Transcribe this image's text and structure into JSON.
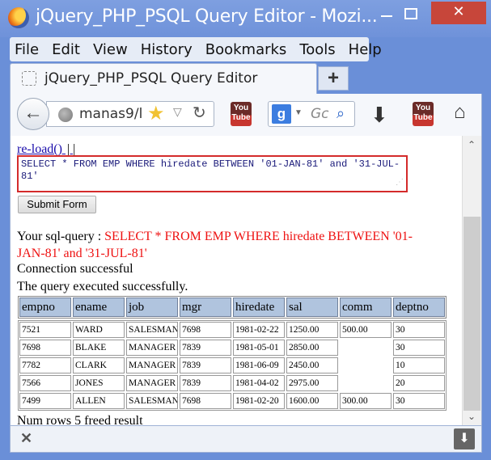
{
  "window": {
    "title": "jQuery_PHP_PSQL Query Editor - Mozi...",
    "close_glyph": "✕"
  },
  "menu": [
    "File",
    "Edit",
    "View",
    "History",
    "Bookmarks",
    "Tools",
    "Help"
  ],
  "tab": {
    "label": "jQuery_PHP_PSQL Query Editor",
    "new_tab": "+"
  },
  "navbar": {
    "url": "manas9/l",
    "search_engine": "g",
    "search_placeholder": "Gc",
    "youtube_label": "You Tube"
  },
  "page": {
    "reload_link": "re-load()",
    "reload_sep": "| |",
    "query_text": "SELECT * FROM EMP WHERE hiredate BETWEEN '01-JAN-81' and '31-JUL-81'",
    "submit_label": "Submit Form",
    "sql_label": "Your sql-query : ",
    "sql_text": "SELECT * FROM EMP WHERE hiredate BETWEEN '01-JAN-81' and '31-JUL-81'",
    "connection_msg": "Connection successful",
    "exec_msg": "The query executed successfully.",
    "num_rows_msg": "Num rows 5 freed result",
    "columns": [
      "empno",
      "ename",
      "job",
      "mgr",
      "hiredate",
      "sal",
      "comm",
      "deptno"
    ],
    "rows": [
      [
        "7521",
        "WARD",
        "SALESMAN",
        "7698",
        "1981-02-22",
        "1250.00",
        "500.00",
        "30"
      ],
      [
        "7698",
        "BLAKE",
        "MANAGER",
        "7839",
        "1981-05-01",
        "2850.00",
        "",
        "30"
      ],
      [
        "7782",
        "CLARK",
        "MANAGER",
        "7839",
        "1981-06-09",
        "2450.00",
        "",
        "10"
      ],
      [
        "7566",
        "JONES",
        "MANAGER",
        "7839",
        "1981-04-02",
        "2975.00",
        "",
        "20"
      ],
      [
        "7499",
        "ALLEN",
        "SALESMAN",
        "7698",
        "1981-02-20",
        "1600.00",
        "300.00",
        "30"
      ]
    ]
  },
  "colors": {
    "titlebar": "#6f92da",
    "query_border": "#d42b2b",
    "sql_text": "#ee1111",
    "header_cell": "#b0c4de",
    "close_button": "#c7463a"
  }
}
